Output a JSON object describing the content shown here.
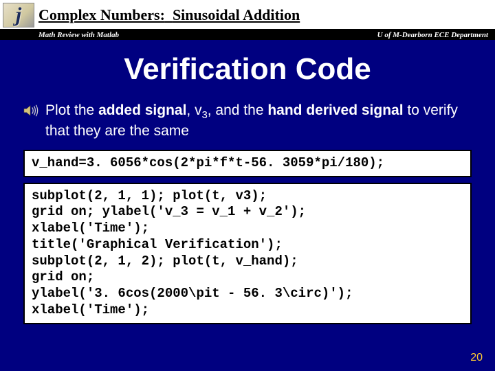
{
  "header": {
    "logo_letter": "j",
    "breadcrumb_a": "Complex Numbers:",
    "breadcrumb_b": "Sinusoidal Addition",
    "sub_left": "Math Review with Matlab",
    "sub_right": "U of M-Dearborn ECE Department"
  },
  "title": "Verification Code",
  "bullet": {
    "t1": "Plot the ",
    "b1": "added signal",
    "t2": ", v",
    "sub": "3",
    "t3": ", and the ",
    "b2": "hand derived signal",
    "t4": " to verify that they are the same"
  },
  "code1": "v_hand=3. 6056*cos(2*pi*f*t-56. 3059*pi/180);",
  "code2": "subplot(2, 1, 1); plot(t, v3);\ngrid on; ylabel('v_3 = v_1 + v_2');\nxlabel('Time');\ntitle('Graphical Verification');\nsubplot(2, 1, 2); plot(t, v_hand);\ngrid on;\nylabel('3. 6cos(2000\\pit - 56. 3\\circ)');\nxlabel('Time');",
  "page_number": "20"
}
